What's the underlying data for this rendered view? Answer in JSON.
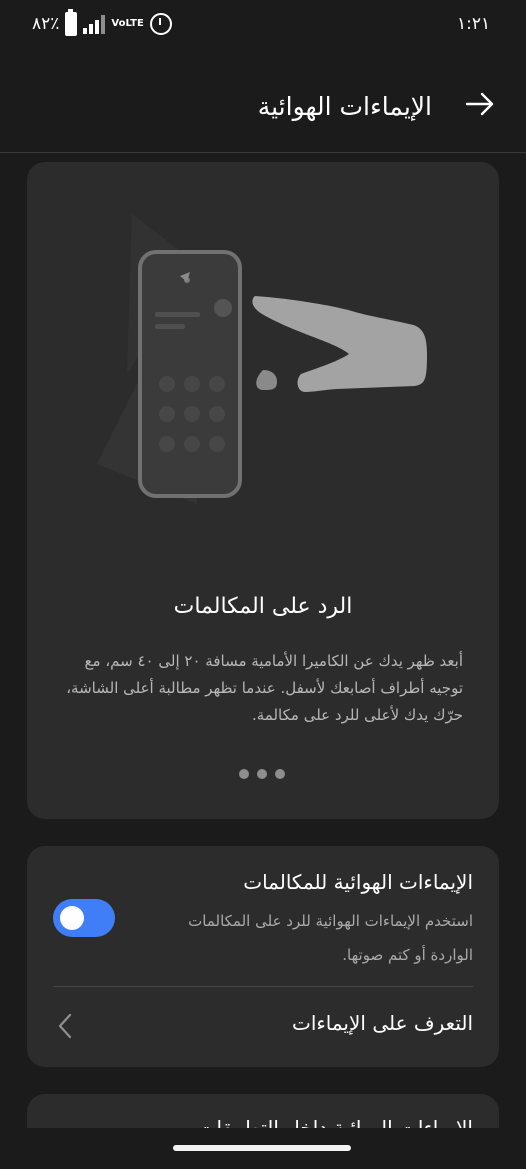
{
  "status_bar": {
    "time": "١:٢١",
    "battery_percent": "٨٢٪",
    "network": "VoLTE"
  },
  "header": {
    "title": "الإيماءات الهوائية",
    "back_icon": "arrow-right-icon"
  },
  "illustration_card": {
    "title": "الرد على المكالمات",
    "description": "أبعد ظهر يدك عن الكاميرا الأمامية مسافة ٢٠ إلى ٤٠ سم، مع توجيه أطراف أصابعك لأسفل. عندما تظهر مطالبة أعلى الشاشة، حرّك يدك لأعلى للرد على مكالمة.",
    "page_count": 3
  },
  "settings": {
    "toggle_title": "الإيماءات الهوائية للمكالمات",
    "toggle_description": "استخدم الإيماءات الهوائية للرد على المكالمات الواردة أو كتم صوتها.",
    "toggle_on": true,
    "accent_color": "#3f7ef6",
    "learn_label": "التعرف على الإيماءات"
  },
  "next_card": {
    "title_partial": "الإيماءات الهوائية داخل التطبيقات"
  }
}
